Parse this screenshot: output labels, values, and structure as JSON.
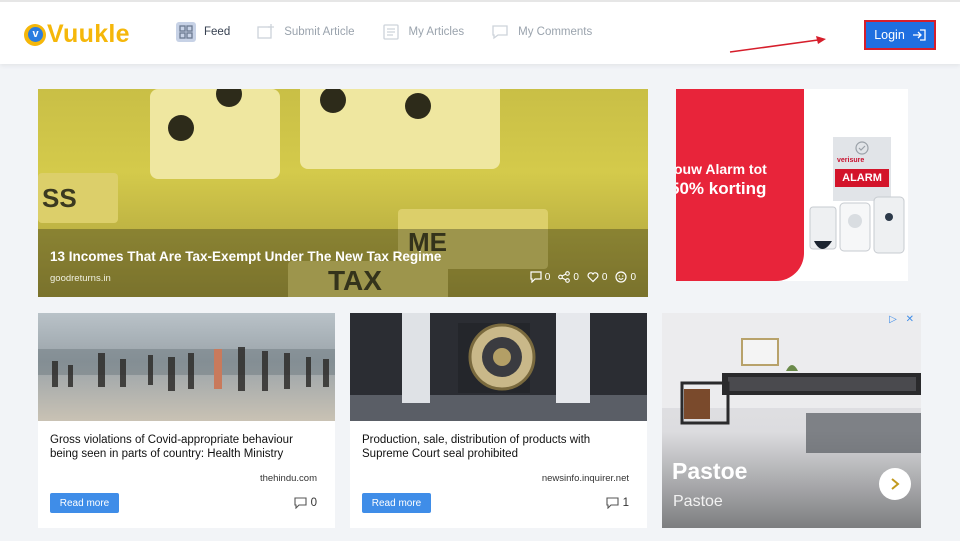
{
  "brand": {
    "logo_badge": "v",
    "name": "Vuukle"
  },
  "nav": {
    "items": [
      {
        "label": "Feed",
        "icon": "grid-icon"
      },
      {
        "label": "Submit Article",
        "icon": "submit-article-icon"
      },
      {
        "label": "My Articles",
        "icon": "articles-icon"
      },
      {
        "label": "My Comments",
        "icon": "comments-icon"
      }
    ],
    "active_index": 0
  },
  "auth": {
    "login_label": "Login",
    "icon": "login-arrow-icon"
  },
  "hero": {
    "title": "13 Incomes That Are Tax-Exempt Under The New Tax Regime",
    "source": "goodreturns.in",
    "image_text": {
      "left_tile": "SS",
      "right_tile": "ME",
      "bottom_tile": "TAX"
    },
    "stats": {
      "comments": "0",
      "shares": "0",
      "likes": "0",
      "reactions": "0"
    }
  },
  "ad_top": {
    "line1": "ouw Alarm tot",
    "line2": "50% korting",
    "brand": "verisure",
    "sign": "ALARM"
  },
  "cards": [
    {
      "title": "Gross violations of Covid-appropriate behaviour being seen in parts of country: Health Ministry",
      "source": "thehindu.com",
      "read_more": "Read more",
      "comments": "0"
    },
    {
      "title": "Production, sale, distribution of products with Supreme Court seal prohibited",
      "source": "newsinfo.inquirer.net",
      "read_more": "Read more",
      "comments": "1"
    }
  ],
  "ad_bottom": {
    "title": "Pastoe",
    "subtitle": "Pastoe",
    "badge": "▷ ✕"
  },
  "colors": {
    "brand_yellow": "#f5b70a",
    "brand_blue": "#1f6fe0",
    "read_more": "#3f8de8",
    "ad_red": "#e8243a",
    "annotation_red": "#d61e2b"
  }
}
